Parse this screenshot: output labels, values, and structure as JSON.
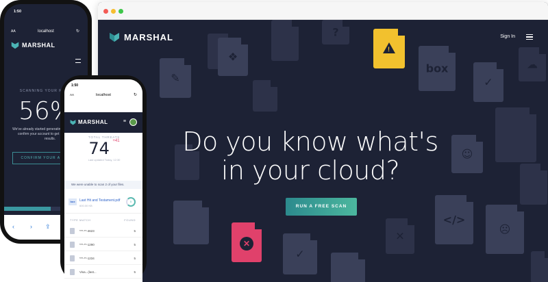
{
  "desktop": {
    "brand": "MARSHAL",
    "signin_label": "Sign In",
    "headline_line1": "Do you know what's",
    "headline_line2": "in your cloud?",
    "cta_label": "RUN A FREE SCAN",
    "file_symbols": {
      "dropbox": "❖",
      "pdf": "✎",
      "box": "box",
      "check": "✓",
      "cloud": "☁",
      "code": "</>",
      "happy": "☺",
      "sad": "☹",
      "question": "?",
      "close": "✕"
    },
    "colors": {
      "background": "#1d2235",
      "warning": "#f2c12e",
      "danger": "#e0416b",
      "cta_start": "#2c8a8d",
      "cta_end": "#4cb79e"
    }
  },
  "phone_left": {
    "time": "1:50",
    "aa": "AA",
    "url": "localhost",
    "brand": "MARSHAL",
    "scan_label": "SCANNING YOUR FILES",
    "percent": "56%",
    "progress": 0.56,
    "note": "We've already started generating a report. Please confirm your account to get access to your results.",
    "button_label": "CONFIRM YOUR ACCOUNT"
  },
  "phone_right": {
    "time": "1:50",
    "aa": "AA",
    "url": "localhost",
    "brand": "MARSHAL",
    "threats_label": "TOTAL THREATS",
    "threats_count": "74",
    "threats_delta": "+41",
    "updated": "Last updated Today, 12:30",
    "alert": "We were unable to scan 2 of your files.",
    "item_title": "Last Hit and Testament.pdf",
    "item_sub": "600.00 KB",
    "item_service": "box",
    "ring_value": "5",
    "table_headers": [
      "TYPE",
      "MATCH",
      "FOUND"
    ],
    "rows": [
      {
        "name": "***-**-4623",
        "count": "5"
      },
      {
        "name": "***-**-1290",
        "count": "5"
      },
      {
        "name": "***-**-1234",
        "count": "5"
      },
      {
        "name": "Visa...(last...",
        "count": "5"
      }
    ]
  }
}
